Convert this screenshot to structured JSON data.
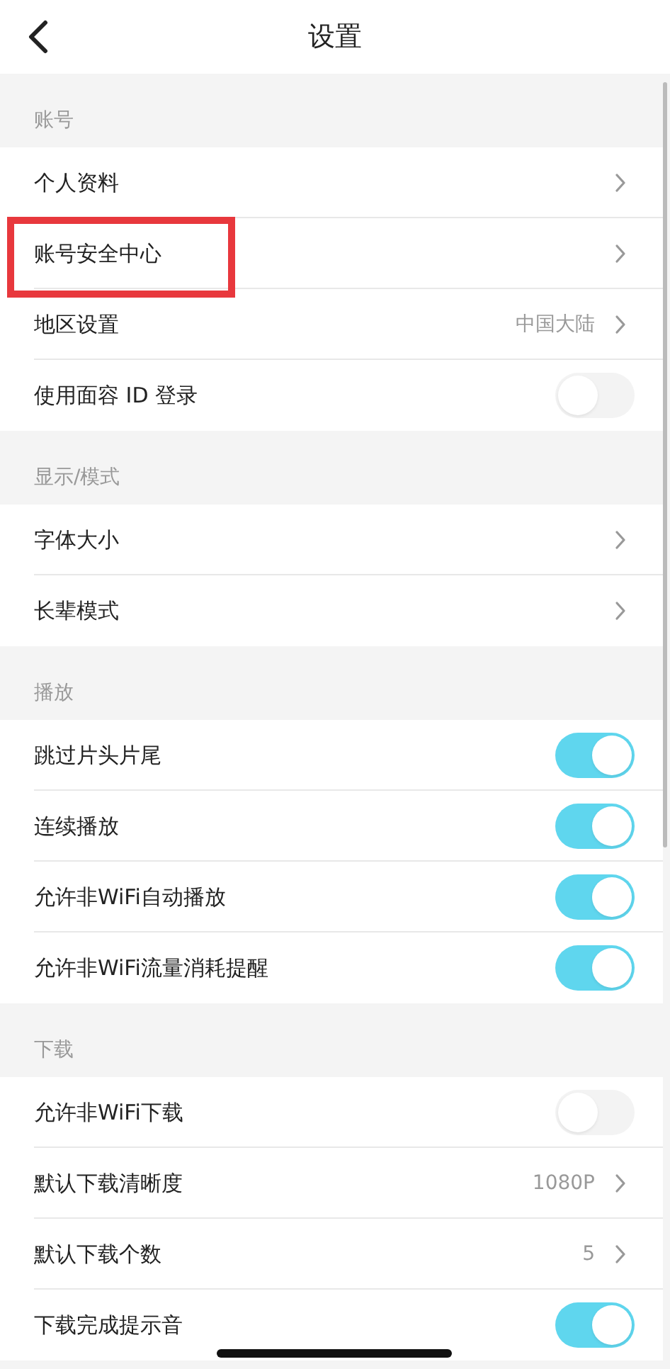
{
  "header": {
    "title": "设置"
  },
  "sections": [
    {
      "title": "账号",
      "rows": [
        {
          "kind": "link",
          "label": "个人资料",
          "highlighted": false
        },
        {
          "kind": "link",
          "label": "账号安全中心",
          "highlighted": true
        },
        {
          "kind": "link",
          "label": "地区设置",
          "value": "中国大陆",
          "highlighted": false
        },
        {
          "kind": "toggle",
          "label": "使用面容 ID 登录",
          "on": false,
          "highlighted": false
        }
      ]
    },
    {
      "title": "显示/模式",
      "rows": [
        {
          "kind": "link",
          "label": "字体大小",
          "highlighted": false
        },
        {
          "kind": "link",
          "label": "长辈模式",
          "highlighted": false
        }
      ]
    },
    {
      "title": "播放",
      "rows": [
        {
          "kind": "toggle",
          "label": "跳过片头片尾",
          "on": true,
          "highlighted": false
        },
        {
          "kind": "toggle",
          "label": "连续播放",
          "on": true,
          "highlighted": false
        },
        {
          "kind": "toggle",
          "label": "允许非WiFi自动播放",
          "on": true,
          "highlighted": false
        },
        {
          "kind": "toggle",
          "label": "允许非WiFi流量消耗提醒",
          "on": true,
          "highlighted": false
        }
      ]
    },
    {
      "title": "下载",
      "rows": [
        {
          "kind": "toggle",
          "label": "允许非WiFi下载",
          "on": false,
          "highlighted": false
        },
        {
          "kind": "link",
          "label": "默认下载清晰度",
          "value": "1080P",
          "highlighted": false
        },
        {
          "kind": "link",
          "label": "默认下载个数",
          "value": "5",
          "highlighted": false
        },
        {
          "kind": "toggle",
          "label": "下载完成提示音",
          "on": true,
          "highlighted": false
        }
      ]
    }
  ]
}
